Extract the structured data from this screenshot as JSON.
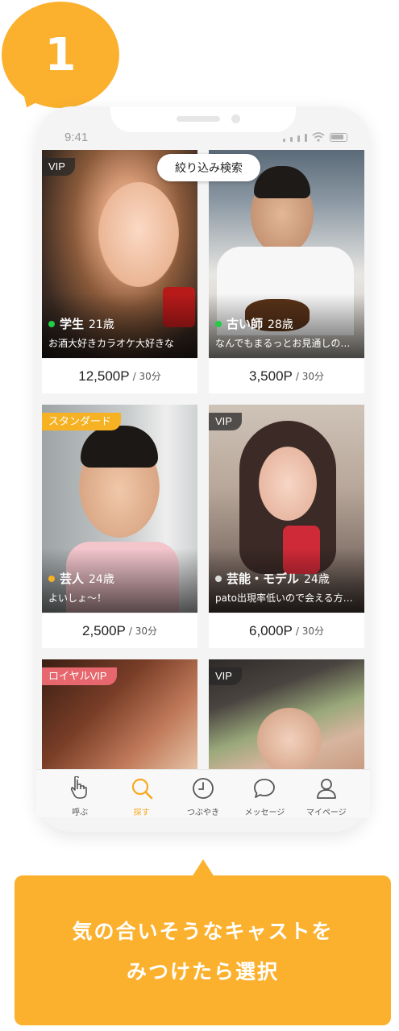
{
  "step": {
    "number": "1"
  },
  "status_bar": {
    "time": "9:41"
  },
  "filter": {
    "label": "絞り込み検索"
  },
  "casts": [
    {
      "tag": "VIP",
      "tag_style": "vip",
      "status_color": "#22cc44",
      "job": "学生",
      "age": "21歳",
      "message": "お酒大好きカラオケ大好きな",
      "price": "12,500P",
      "unit": "/ 30分"
    },
    {
      "tag": "",
      "tag_style": "",
      "status_color": "#22cc44",
      "job": "古い師",
      "age": "28歳",
      "message": "なんでもまるっとお見通しの…",
      "price": "3,500P",
      "unit": "/ 30分"
    },
    {
      "tag": "スタンダード",
      "tag_style": "standard",
      "status_color": "#f6b222",
      "job": "芸人",
      "age": "24歳",
      "message": "よいしょ〜！",
      "price": "2,500P",
      "unit": "/ 30分"
    },
    {
      "tag": "VIP",
      "tag_style": "vip",
      "status_color": "#dddddd",
      "job": "芸能・モデル",
      "age": "24歳",
      "message": "pato出現率低いので会える方…",
      "price": "6,000P",
      "unit": "/ 30分"
    },
    {
      "tag": "ロイヤルVIP",
      "tag_style": "royal"
    },
    {
      "tag": "VIP",
      "tag_style": "vip"
    }
  ],
  "tabs": [
    {
      "label": "呼ぶ",
      "icon": "hand-pointer-icon",
      "active": false
    },
    {
      "label": "探す",
      "icon": "search-icon",
      "active": true
    },
    {
      "label": "つぶやき",
      "icon": "clock-icon",
      "active": false
    },
    {
      "label": "メッセージ",
      "icon": "chat-bubble-icon",
      "active": false
    },
    {
      "label": "マイページ",
      "icon": "user-icon",
      "active": false
    }
  ],
  "caption": {
    "line1": "気の合いそうなキャストを",
    "line2": "みつけたら選択"
  },
  "colors": {
    "accent": "#fbb12e",
    "active_tab": "#f6a91e",
    "online": "#22cc44"
  }
}
